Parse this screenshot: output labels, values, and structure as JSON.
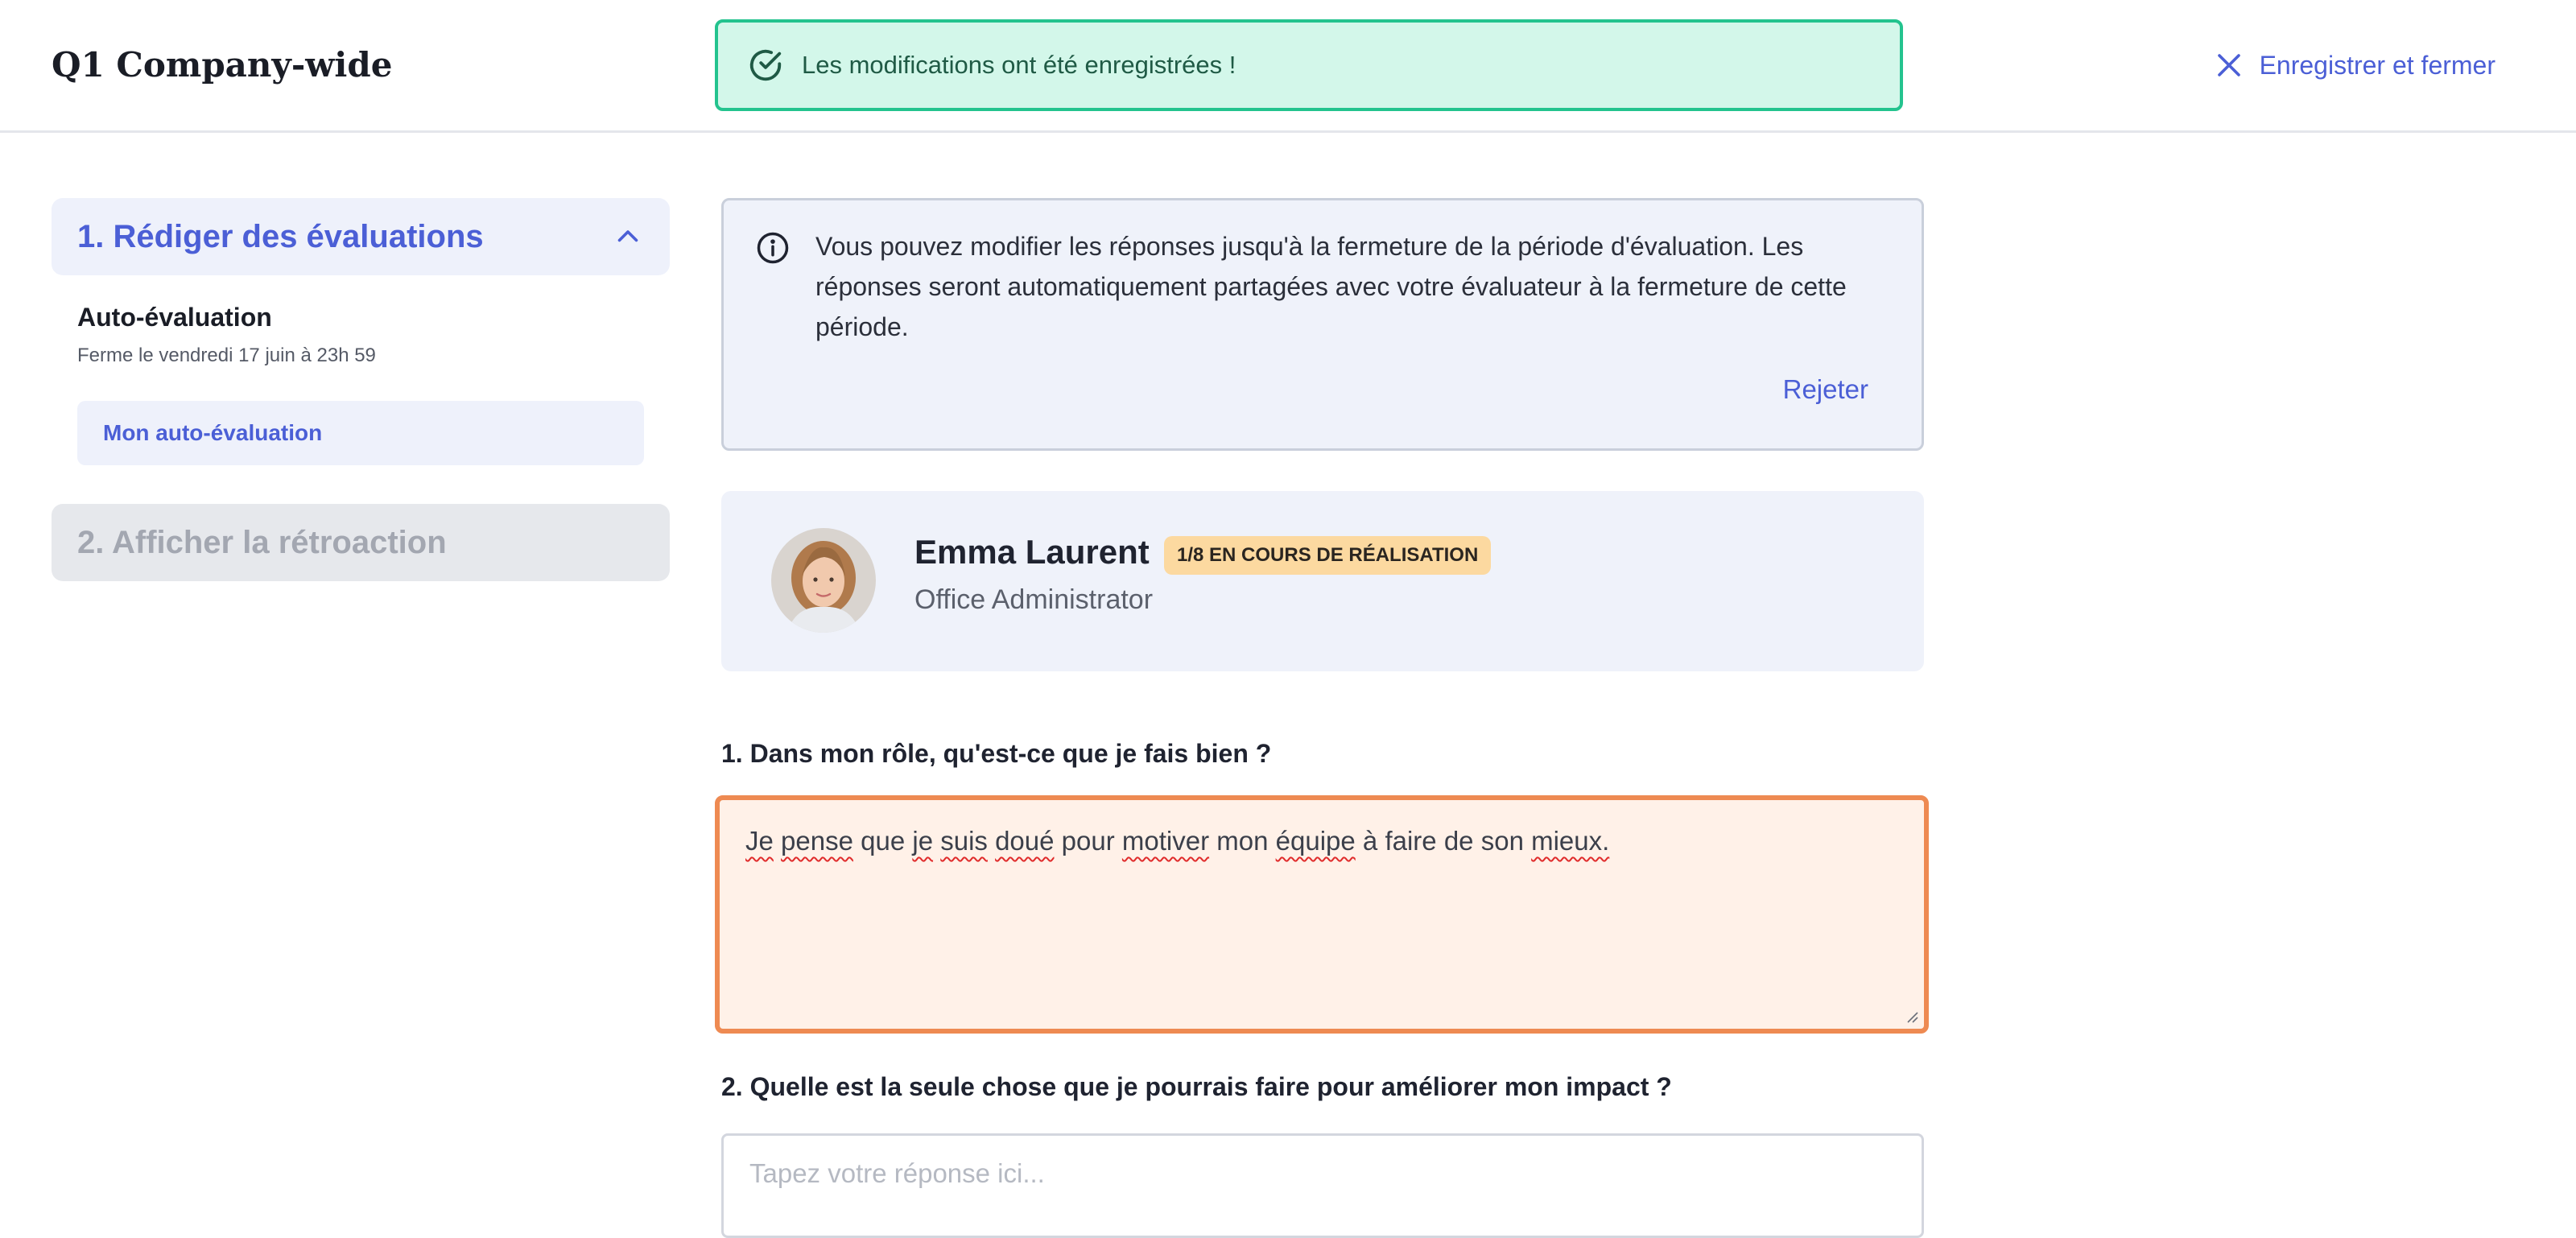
{
  "header": {
    "title": "Q1 Company-wide",
    "toast": "Les modifications ont été enregistrées !",
    "save_close": "Enregistrer et fermer"
  },
  "sidebar": {
    "step1": "1. Rédiger des évaluations",
    "section_title": "Auto-évaluation",
    "section_deadline": "Ferme le vendredi 17 juin à 23h 59",
    "nav_item": "Mon auto-évaluation",
    "step2": "2. Afficher la rétroaction"
  },
  "notice": {
    "text": "Vous pouvez modifier les réponses jusqu'à la fermeture de la période d'évaluation. Les réponses seront automatiquement partagées avec votre évaluateur à la fermeture de cette période.",
    "dismiss": "Rejeter"
  },
  "person": {
    "name": "Emma Laurent",
    "status": "1/8 EN COURS DE RÉALISATION",
    "role": "Office Administrator"
  },
  "questions": [
    {
      "label": "1. Dans mon rôle, qu'est-ce que je fais bien ?",
      "answer_words": [
        "Je",
        "pense",
        "que",
        "je",
        "suis",
        "doué",
        "pour",
        "motiver",
        "mon",
        "équipe",
        "à",
        "faire",
        "de",
        "son",
        "mieux."
      ],
      "misspelled_index": [
        0,
        1,
        3,
        4,
        5,
        7,
        9,
        14
      ]
    },
    {
      "label": "2. Quelle est la seule chose que je pourrais faire pour améliorer mon impact ?",
      "placeholder": "Tapez votre réponse ici..."
    }
  ],
  "colors": {
    "accent": "#4b5fd6",
    "success_bg": "#d3f7ea",
    "success_border": "#23c38e",
    "focus_border": "#ee8a52",
    "badge_bg": "#fcd9a0"
  }
}
